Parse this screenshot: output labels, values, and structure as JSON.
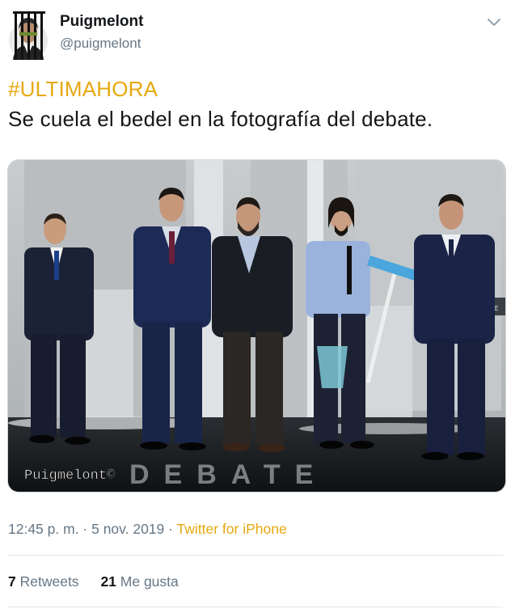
{
  "tweet": {
    "author_name": "Puigmelont",
    "author_handle": "@puigmelont",
    "hashtag": "#ULTIMAHORA",
    "text": "Se cuela el bedel en la fotografía del debate.",
    "timestamp": "12:45 p. m. · 5 nov. 2019",
    "separator": " · ",
    "source": "Twitter for iPhone",
    "retweets_count": "7",
    "retweets_label": "Retweets",
    "likes_count": "21",
    "likes_label": "Me gusta"
  },
  "media": {
    "watermark": "Puigmelont©",
    "floor_text": "DEBATE",
    "screen_tag": "TE"
  },
  "colors": {
    "accent": "#e7a80e",
    "secondary_text": "#657786",
    "divider": "#e1e8ed"
  },
  "icons": {
    "menu": "chevron-down-icon"
  }
}
